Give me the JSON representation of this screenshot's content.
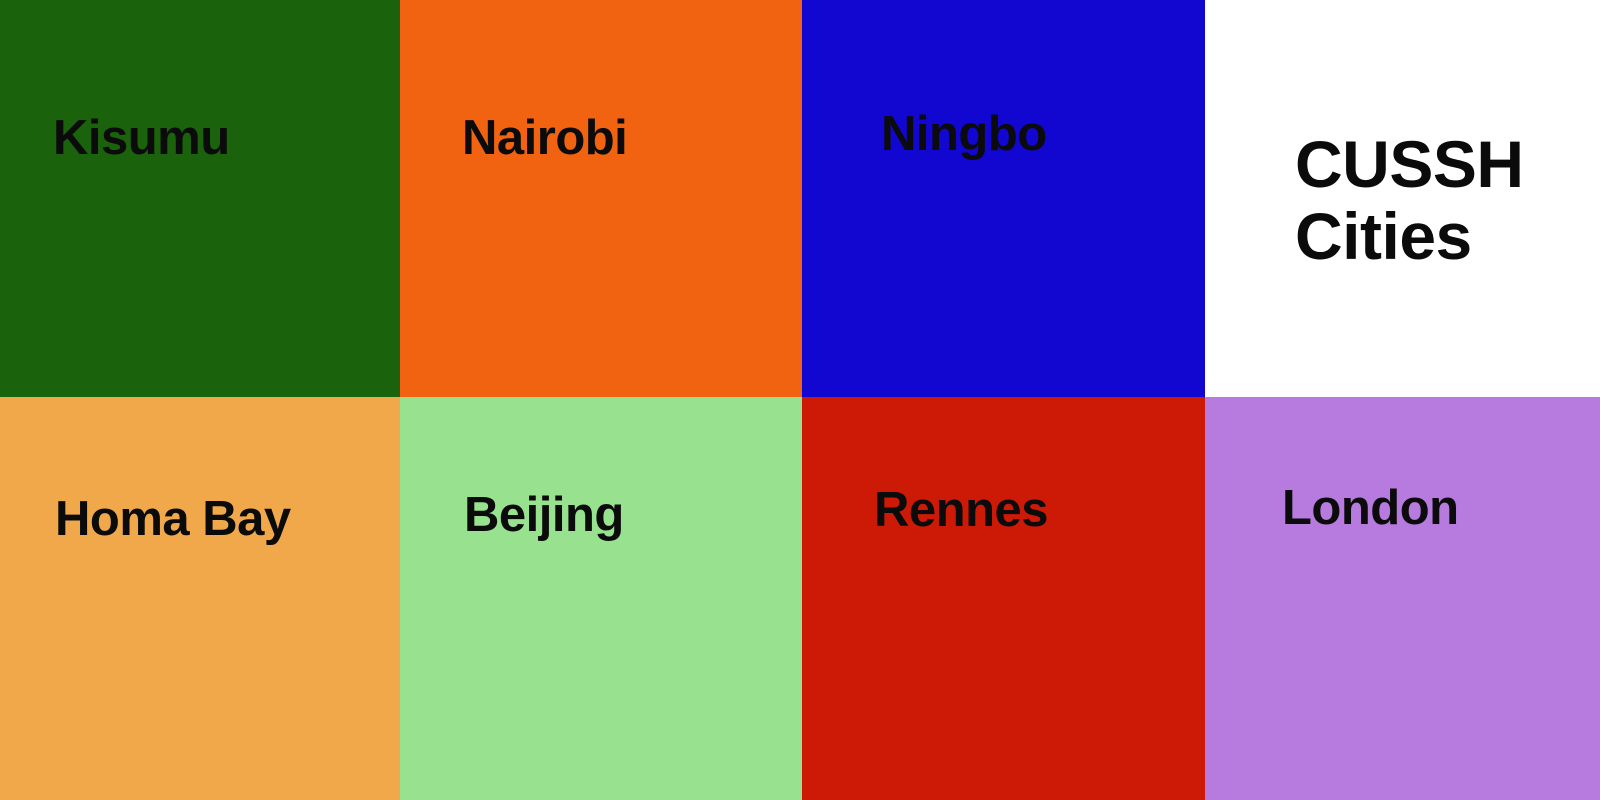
{
  "tiles": [
    {
      "label": "Kisumu",
      "color": "#1b620d"
    },
    {
      "label": "Nairobi",
      "color": "#f26311"
    },
    {
      "label": "Ningbo",
      "color": "#1207d1"
    },
    {
      "label": "CUSSH Cities",
      "color": "#ffffff"
    },
    {
      "label": "Homa Bay",
      "color": "#f0a84b"
    },
    {
      "label": "Beijing",
      "color": "#98e28f"
    },
    {
      "label": "Rennes",
      "color": "#cc1a07"
    },
    {
      "label": "London",
      "color": "#b77ade"
    }
  ]
}
